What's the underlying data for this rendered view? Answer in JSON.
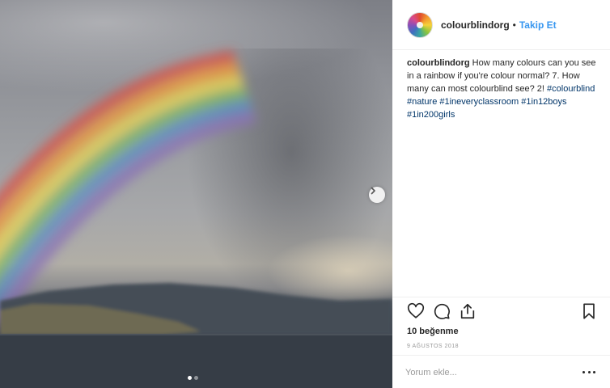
{
  "post": {
    "username": "colourblindorg",
    "separator": "•",
    "follow_label": "Takip Et",
    "caption": {
      "username": "colourblindorg",
      "text": " How many colours can you see in a rainbow if you're colour normal? 7. How many can most colourblind see? 2! ",
      "hashtags": [
        "#colourblind",
        "#nature",
        "#1ineveryclassroom",
        "#1in12boys",
        "#1in200girls"
      ]
    },
    "likes": "10 beğenme",
    "date": "9 AĞUSTOS 2018",
    "comment_placeholder": "Yorum ekle...",
    "carousel": {
      "slides": 2,
      "active": 1
    }
  },
  "icons": {
    "next": "chevron-right-icon",
    "like": "heart-icon",
    "comment": "comment-bubble-icon",
    "share": "share-icon",
    "save": "bookmark-icon",
    "more": "more-options-icon"
  },
  "colors": {
    "follow": "#3897f0",
    "hashtag": "#003569",
    "muted": "#999999",
    "text": "#262626"
  }
}
